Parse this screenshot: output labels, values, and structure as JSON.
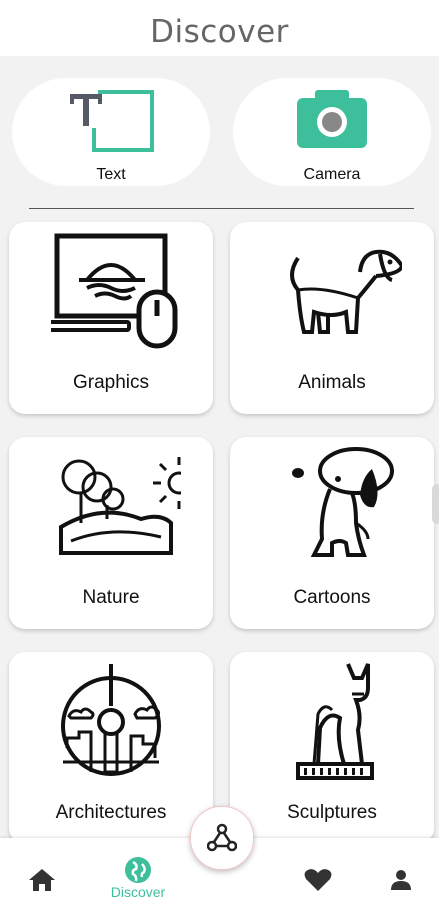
{
  "header": {
    "title": "Discover"
  },
  "modes": [
    {
      "label": "Text"
    },
    {
      "label": "Camera"
    }
  ],
  "categories": [
    {
      "label": "Graphics"
    },
    {
      "label": "Animals"
    },
    {
      "label": "Nature"
    },
    {
      "label": "Cartoons"
    },
    {
      "label": "Architectures"
    },
    {
      "label": "Sculptures"
    }
  ],
  "nav": {
    "discover_label": "Discover",
    "active": "discover"
  },
  "colors": {
    "accent": "#3cbf9a",
    "icon_dark": "#333333",
    "background": "#f2f2f2"
  }
}
